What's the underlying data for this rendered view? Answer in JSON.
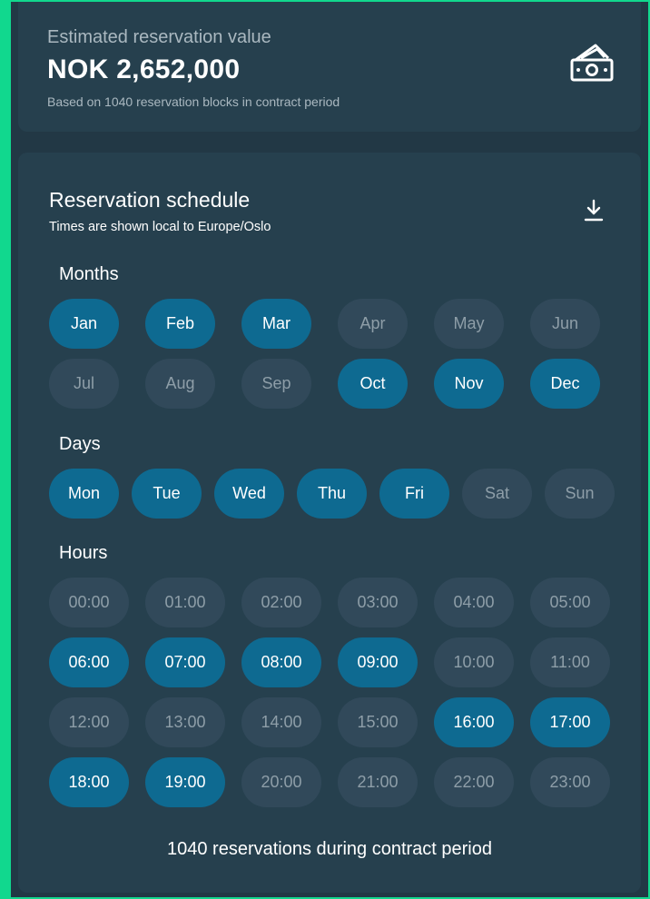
{
  "value_card": {
    "label": "Estimated reservation value",
    "amount": "NOK 2,652,000",
    "note": "Based on 1040 reservation blocks in contract period",
    "icon": "money-icon"
  },
  "schedule": {
    "title": "Reservation schedule",
    "timezone_note": "Times are shown local to Europe/Oslo",
    "download_icon": "download-icon",
    "months_label": "Months",
    "months": [
      {
        "label": "Jan",
        "selected": true
      },
      {
        "label": "Feb",
        "selected": true
      },
      {
        "label": "Mar",
        "selected": true
      },
      {
        "label": "Apr",
        "selected": false
      },
      {
        "label": "May",
        "selected": false
      },
      {
        "label": "Jun",
        "selected": false
      },
      {
        "label": "Jul",
        "selected": false
      },
      {
        "label": "Aug",
        "selected": false
      },
      {
        "label": "Sep",
        "selected": false
      },
      {
        "label": "Oct",
        "selected": true
      },
      {
        "label": "Nov",
        "selected": true
      },
      {
        "label": "Dec",
        "selected": true
      }
    ],
    "days_label": "Days",
    "days": [
      {
        "label": "Mon",
        "selected": true
      },
      {
        "label": "Tue",
        "selected": true
      },
      {
        "label": "Wed",
        "selected": true
      },
      {
        "label": "Thu",
        "selected": true
      },
      {
        "label": "Fri",
        "selected": true
      },
      {
        "label": "Sat",
        "selected": false
      },
      {
        "label": "Sun",
        "selected": false
      }
    ],
    "hours_label": "Hours",
    "hours": [
      {
        "label": "00:00",
        "selected": false
      },
      {
        "label": "01:00",
        "selected": false
      },
      {
        "label": "02:00",
        "selected": false
      },
      {
        "label": "03:00",
        "selected": false
      },
      {
        "label": "04:00",
        "selected": false
      },
      {
        "label": "05:00",
        "selected": false
      },
      {
        "label": "06:00",
        "selected": true
      },
      {
        "label": "07:00",
        "selected": true
      },
      {
        "label": "08:00",
        "selected": true
      },
      {
        "label": "09:00",
        "selected": true
      },
      {
        "label": "10:00",
        "selected": false
      },
      {
        "label": "11:00",
        "selected": false
      },
      {
        "label": "12:00",
        "selected": false
      },
      {
        "label": "13:00",
        "selected": false
      },
      {
        "label": "14:00",
        "selected": false
      },
      {
        "label": "15:00",
        "selected": false
      },
      {
        "label": "16:00",
        "selected": true
      },
      {
        "label": "17:00",
        "selected": true
      },
      {
        "label": "18:00",
        "selected": true
      },
      {
        "label": "19:00",
        "selected": true
      },
      {
        "label": "20:00",
        "selected": false
      },
      {
        "label": "21:00",
        "selected": false
      },
      {
        "label": "22:00",
        "selected": false
      },
      {
        "label": "23:00",
        "selected": false
      }
    ],
    "footer": "1040 reservations during contract period"
  },
  "colors": {
    "accent_border": "#11d88e",
    "selected_pill": "#0e6a91",
    "unselected_pill": "#31495a",
    "card_bg": "#26404e"
  }
}
